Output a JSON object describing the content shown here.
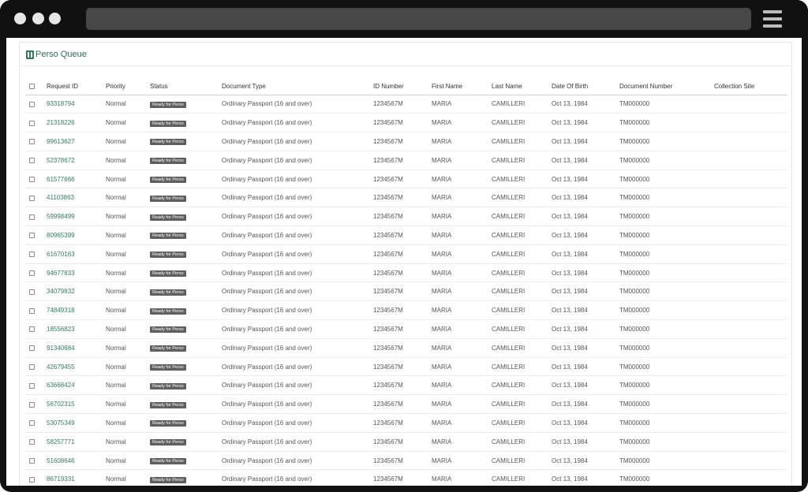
{
  "page": {
    "title": "Perso Queue",
    "title_icon": "queue-icon"
  },
  "colors": {
    "accent": "#2f7d5c",
    "badge_bg": "#5f5f5f",
    "frame": "#111111"
  },
  "table": {
    "columns": [
      "Request ID",
      "Priority",
      "Status",
      "Document Type",
      "ID Number",
      "First Name",
      "Last Name",
      "Date Of Birth",
      "Document Number",
      "Collection Site"
    ],
    "rows": [
      {
        "request_id": "93318794",
        "priority": "Normal",
        "status": "Ready for Perso",
        "document_type": "Ordinary Passport (16 and over)",
        "id_number": "1234567M",
        "first_name": "MARIA",
        "last_name": "CAMILLERI",
        "dob": "Oct 13, 1984",
        "document_number": "TM000000",
        "collection_site": ""
      },
      {
        "request_id": "21318226",
        "priority": "Normal",
        "status": "Ready for Perso",
        "document_type": "Ordinary Passport (16 and over)",
        "id_number": "1234567M",
        "first_name": "MARIA",
        "last_name": "CAMILLERI",
        "dob": "Oct 13, 1984",
        "document_number": "TM000000",
        "collection_site": ""
      },
      {
        "request_id": "99613627",
        "priority": "Normal",
        "status": "Ready for Perso",
        "document_type": "Ordinary Passport (16 and over)",
        "id_number": "1234567M",
        "first_name": "MARIA",
        "last_name": "CAMILLERI",
        "dob": "Oct 13, 1984",
        "document_number": "TM000000",
        "collection_site": ""
      },
      {
        "request_id": "52378672",
        "priority": "Normal",
        "status": "Ready for Perso",
        "document_type": "Ordinary Passport (16 and over)",
        "id_number": "1234567M",
        "first_name": "MARIA",
        "last_name": "CAMILLERI",
        "dob": "Oct 13, 1984",
        "document_number": "TM000000",
        "collection_site": ""
      },
      {
        "request_id": "61577666",
        "priority": "Normal",
        "status": "Ready for Perso",
        "document_type": "Ordinary Passport (16 and over)",
        "id_number": "1234567M",
        "first_name": "MARIA",
        "last_name": "CAMILLERI",
        "dob": "Oct 13, 1984",
        "document_number": "TM000000",
        "collection_site": ""
      },
      {
        "request_id": "41103863",
        "priority": "Normal",
        "status": "Ready for Perso",
        "document_type": "Ordinary Passport (16 and over)",
        "id_number": "1234567M",
        "first_name": "MARIA",
        "last_name": "CAMILLERI",
        "dob": "Oct 13, 1984",
        "document_number": "TM000000",
        "collection_site": ""
      },
      {
        "request_id": "59998499",
        "priority": "Normal",
        "status": "Ready for Perso",
        "document_type": "Ordinary Passport (16 and over)",
        "id_number": "1234567M",
        "first_name": "MARIA",
        "last_name": "CAMILLERI",
        "dob": "Oct 13, 1984",
        "document_number": "TM000000",
        "collection_site": ""
      },
      {
        "request_id": "80965399",
        "priority": "Normal",
        "status": "Ready for Perso",
        "document_type": "Ordinary Passport (16 and over)",
        "id_number": "1234567M",
        "first_name": "MARIA",
        "last_name": "CAMILLERI",
        "dob": "Oct 13, 1984",
        "document_number": "TM000000",
        "collection_site": ""
      },
      {
        "request_id": "61670163",
        "priority": "Normal",
        "status": "Ready for Perso",
        "document_type": "Ordinary Passport (16 and over)",
        "id_number": "1234567M",
        "first_name": "MARIA",
        "last_name": "CAMILLERI",
        "dob": "Oct 13, 1984",
        "document_number": "TM000000",
        "collection_site": ""
      },
      {
        "request_id": "94677833",
        "priority": "Normal",
        "status": "Ready for Perso",
        "document_type": "Ordinary Passport (16 and over)",
        "id_number": "1234567M",
        "first_name": "MARIA",
        "last_name": "CAMILLERI",
        "dob": "Oct 13, 1984",
        "document_number": "TM000000",
        "collection_site": ""
      },
      {
        "request_id": "34079832",
        "priority": "Normal",
        "status": "Ready for Perso",
        "document_type": "Ordinary Passport (16 and over)",
        "id_number": "1234567M",
        "first_name": "MARIA",
        "last_name": "CAMILLERI",
        "dob": "Oct 13, 1984",
        "document_number": "TM000000",
        "collection_site": ""
      },
      {
        "request_id": "74849318",
        "priority": "Normal",
        "status": "Ready for Perso",
        "document_type": "Ordinary Passport (16 and over)",
        "id_number": "1234567M",
        "first_name": "MARIA",
        "last_name": "CAMILLERI",
        "dob": "Oct 13, 1984",
        "document_number": "TM000000",
        "collection_site": ""
      },
      {
        "request_id": "18556823",
        "priority": "Normal",
        "status": "Ready for Perso",
        "document_type": "Ordinary Passport (16 and over)",
        "id_number": "1234567M",
        "first_name": "MARIA",
        "last_name": "CAMILLERI",
        "dob": "Oct 13, 1984",
        "document_number": "TM000000",
        "collection_site": ""
      },
      {
        "request_id": "91340684",
        "priority": "Normal",
        "status": "Ready for Perso",
        "document_type": "Ordinary Passport (16 and over)",
        "id_number": "1234567M",
        "first_name": "MARIA",
        "last_name": "CAMILLERI",
        "dob": "Oct 13, 1984",
        "document_number": "TM000000",
        "collection_site": ""
      },
      {
        "request_id": "42679455",
        "priority": "Normal",
        "status": "Ready for Perso",
        "document_type": "Ordinary Passport (16 and over)",
        "id_number": "1234567M",
        "first_name": "MARIA",
        "last_name": "CAMILLERI",
        "dob": "Oct 13, 1984",
        "document_number": "TM000000",
        "collection_site": ""
      },
      {
        "request_id": "63668424",
        "priority": "Normal",
        "status": "Ready for Perso",
        "document_type": "Ordinary Passport (16 and over)",
        "id_number": "1234567M",
        "first_name": "MARIA",
        "last_name": "CAMILLERI",
        "dob": "Oct 13, 1984",
        "document_number": "TM000000",
        "collection_site": ""
      },
      {
        "request_id": "56702315",
        "priority": "Normal",
        "status": "Ready for Perso",
        "document_type": "Ordinary Passport (16 and over)",
        "id_number": "1234567M",
        "first_name": "MARIA",
        "last_name": "CAMILLERI",
        "dob": "Oct 13, 1984",
        "document_number": "TM000000",
        "collection_site": ""
      },
      {
        "request_id": "53075349",
        "priority": "Normal",
        "status": "Ready for Perso",
        "document_type": "Ordinary Passport (16 and over)",
        "id_number": "1234567M",
        "first_name": "MARIA",
        "last_name": "CAMILLERI",
        "dob": "Oct 13, 1984",
        "document_number": "TM000000",
        "collection_site": ""
      },
      {
        "request_id": "58257771",
        "priority": "Normal",
        "status": "Ready for Perso",
        "document_type": "Ordinary Passport (16 and over)",
        "id_number": "1234567M",
        "first_name": "MARIA",
        "last_name": "CAMILLERI",
        "dob": "Oct 13, 1984",
        "document_number": "TM000000",
        "collection_site": ""
      },
      {
        "request_id": "51608646",
        "priority": "Normal",
        "status": "Ready for Perso",
        "document_type": "Ordinary Passport (16 and over)",
        "id_number": "1234567M",
        "first_name": "MARIA",
        "last_name": "CAMILLERI",
        "dob": "Oct 13, 1984",
        "document_number": "TM000000",
        "collection_site": ""
      },
      {
        "request_id": "86719331",
        "priority": "Normal",
        "status": "Ready for Perso",
        "document_type": "Ordinary Passport (16 and over)",
        "id_number": "1234567M",
        "first_name": "MARIA",
        "last_name": "CAMILLERI",
        "dob": "Oct 13, 1984",
        "document_number": "TM000000",
        "collection_site": ""
      }
    ]
  }
}
